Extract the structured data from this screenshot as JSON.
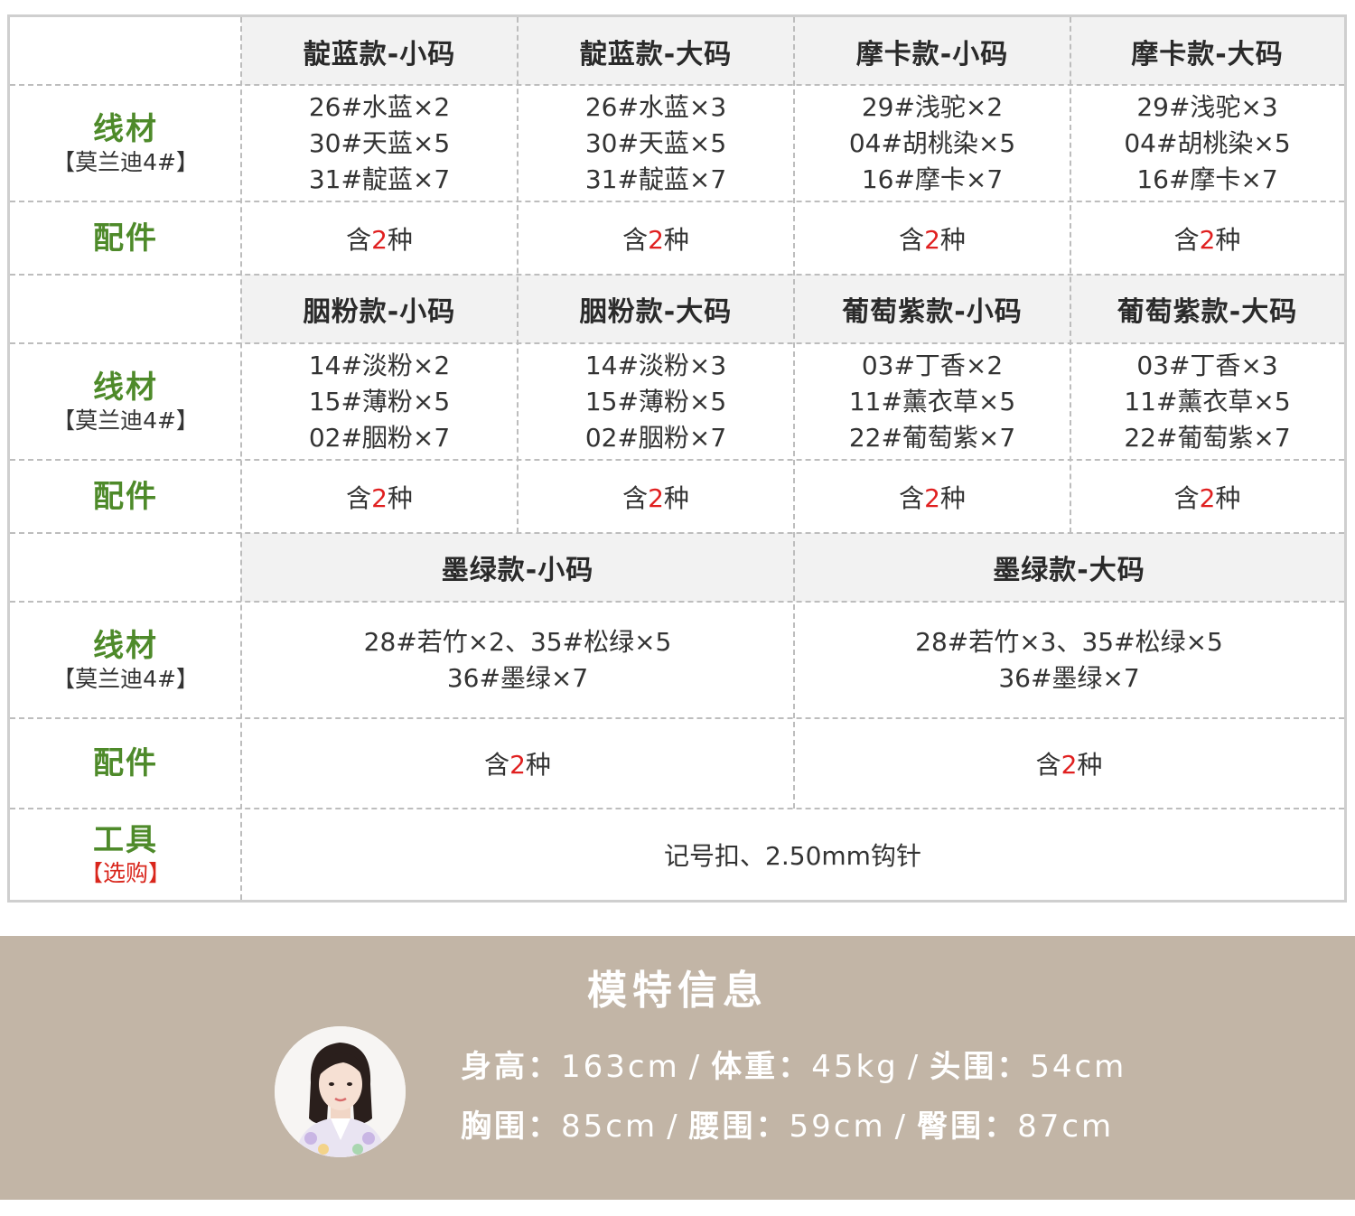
{
  "blocks": [
    {
      "headers": [
        "靛蓝款-小码",
        "靛蓝款-大码",
        "摩卡款-小码",
        "摩卡款-大码"
      ],
      "yarn_label": "线材",
      "yarn_sub": "【莫兰迪4#】",
      "yarns": [
        [
          "26#水蓝×2",
          "30#天蓝×5",
          "31#靛蓝×7"
        ],
        [
          "26#水蓝×3",
          "30#天蓝×5",
          "31#靛蓝×7"
        ],
        [
          "29#浅驼×2",
          "04#胡桃染×5",
          "16#摩卡×7"
        ],
        [
          "29#浅驼×3",
          "04#胡桃染×5",
          "16#摩卡×7"
        ]
      ],
      "accessory_label": "配件",
      "accessories": [
        {
          "pre": "含",
          "num": "2",
          "post": "种"
        },
        {
          "pre": "含",
          "num": "2",
          "post": "种"
        },
        {
          "pre": "含",
          "num": "2",
          "post": "种"
        },
        {
          "pre": "含",
          "num": "2",
          "post": "种"
        }
      ]
    },
    {
      "headers": [
        "胭粉款-小码",
        "胭粉款-大码",
        "葡萄紫款-小码",
        "葡萄紫款-大码"
      ],
      "yarn_label": "线材",
      "yarn_sub": "【莫兰迪4#】",
      "yarns": [
        [
          "14#淡粉×2",
          "15#薄粉×5",
          "02#胭粉×7"
        ],
        [
          "14#淡粉×3",
          "15#薄粉×5",
          "02#胭粉×7"
        ],
        [
          "03#丁香×2",
          "11#薰衣草×5",
          "22#葡萄紫×7"
        ],
        [
          "03#丁香×3",
          "11#薰衣草×5",
          "22#葡萄紫×7"
        ]
      ],
      "accessory_label": "配件",
      "accessories": [
        {
          "pre": "含",
          "num": "2",
          "post": "种"
        },
        {
          "pre": "含",
          "num": "2",
          "post": "种"
        },
        {
          "pre": "含",
          "num": "2",
          "post": "种"
        },
        {
          "pre": "含",
          "num": "2",
          "post": "种"
        }
      ]
    },
    {
      "headers": [
        "墨绿款-小码",
        "墨绿款-大码"
      ],
      "yarn_label": "线材",
      "yarn_sub": "【莫兰迪4#】",
      "yarns": [
        [
          "28#若竹×2、35#松绿×5",
          "36#墨绿×7"
        ],
        [
          "28#若竹×3、35#松绿×5",
          "36#墨绿×7"
        ]
      ],
      "accessory_label": "配件",
      "accessories": [
        {
          "pre": "含",
          "num": "2",
          "post": "种"
        },
        {
          "pre": "含",
          "num": "2",
          "post": "种"
        }
      ]
    }
  ],
  "tools": {
    "label": "工具",
    "sub": "【选购】",
    "value": "记号扣、2.50mm钩针"
  },
  "model_info": {
    "title": "模特信息",
    "line1": [
      {
        "key": "身高：",
        "value": "163cm"
      },
      {
        "key": "体重：",
        "value": "45kg"
      },
      {
        "key": "头围：",
        "value": "54cm"
      }
    ],
    "line2": [
      {
        "key": "胸围：",
        "value": "85cm"
      },
      {
        "key": "腰围：",
        "value": "59cm"
      },
      {
        "key": "臀围：",
        "value": "87cm"
      }
    ],
    "separator": "/"
  },
  "colors": {
    "label_green": "#4e8a2a",
    "highlight_red": "#e02020",
    "model_bg": "#c2b5a6",
    "header_bg": "#f2f2f2"
  }
}
